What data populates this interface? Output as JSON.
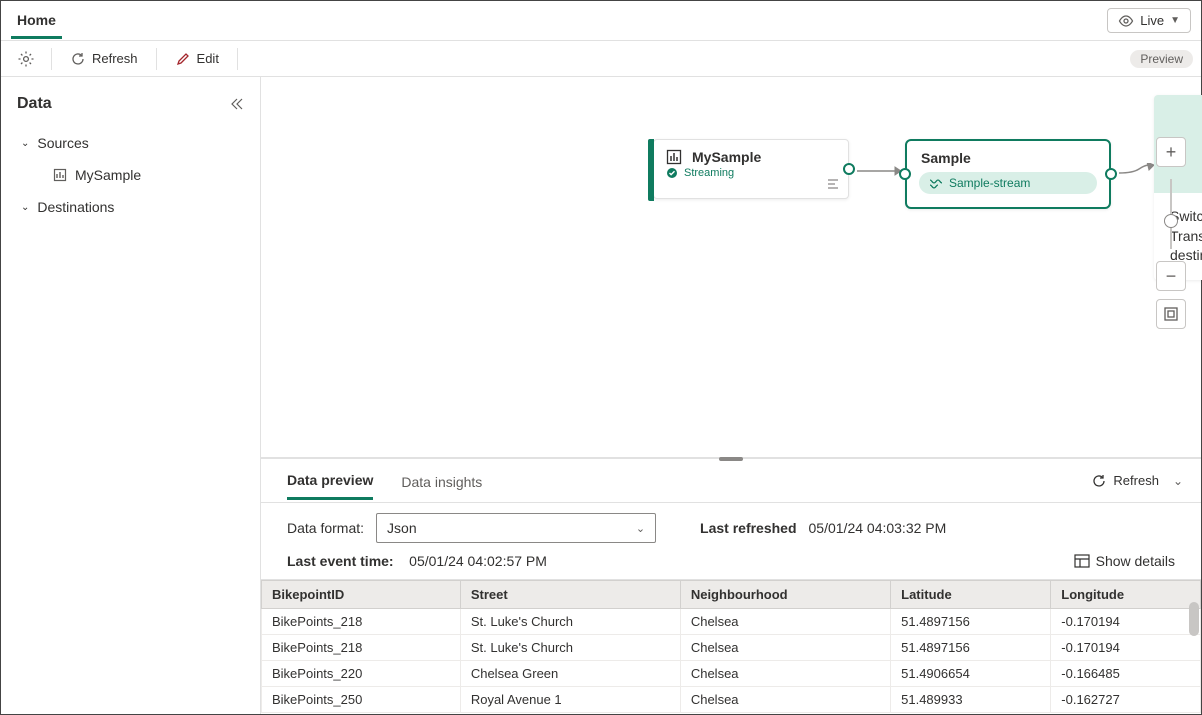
{
  "header": {
    "tab_home": "Home",
    "live": "Live",
    "preview_badge": "Preview"
  },
  "toolbar": {
    "refresh": "Refresh",
    "edit": "Edit"
  },
  "sidebar": {
    "title": "Data",
    "sources_label": "Sources",
    "dest_label": "Destinations",
    "source_item": "MySample"
  },
  "canvas": {
    "source": {
      "title": "MySample",
      "status": "Streaming"
    },
    "stream": {
      "title": "Sample",
      "pill": "Sample-stream"
    },
    "dest_hint": "Switch to edit mode to Transform event or add destination",
    "slash": "/"
  },
  "preview": {
    "tab_preview": "Data preview",
    "tab_insights": "Data insights",
    "refresh": "Refresh",
    "format_label": "Data format:",
    "format_value": "Json",
    "last_refreshed_label": "Last refreshed",
    "last_refreshed_value": "05/01/24 04:03:32 PM",
    "last_event_label": "Last event time:",
    "last_event_value": "05/01/24 04:02:57 PM",
    "show_details": "Show details",
    "columns": [
      "BikepointID",
      "Street",
      "Neighbourhood",
      "Latitude",
      "Longitude"
    ],
    "rows": [
      [
        "BikePoints_218",
        "St. Luke's Church",
        "Chelsea",
        "51.4897156",
        "-0.170194"
      ],
      [
        "BikePoints_218",
        "St. Luke's Church",
        "Chelsea",
        "51.4897156",
        "-0.170194"
      ],
      [
        "BikePoints_220",
        "Chelsea Green",
        "Chelsea",
        "51.4906654",
        "-0.166485"
      ],
      [
        "BikePoints_250",
        "Royal Avenue 1",
        "Chelsea",
        "51.489933",
        "-0.162727"
      ]
    ]
  }
}
